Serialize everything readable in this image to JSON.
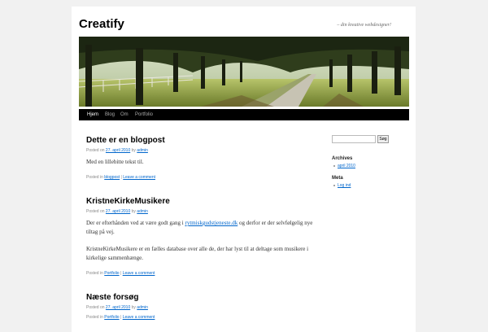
{
  "site": {
    "title": "Creatify",
    "description": "– din kreative webdesigner!"
  },
  "menu": {
    "items": [
      {
        "label": "Hjem",
        "current": true
      },
      {
        "label": "Blog",
        "current": false
      },
      {
        "label": "Om",
        "current": false
      },
      {
        "label": "Portfolio",
        "current": false
      }
    ]
  },
  "posts": [
    {
      "title": "Dette er en blogpost",
      "meta_prefix": "Posted on",
      "date": "27. april 2010",
      "meta_by": "by",
      "author": "admin",
      "paragraphs": [
        {
          "text": "Med en lillebitte tekst til."
        }
      ],
      "util_prefix": "Posted in",
      "category": "blogpost",
      "separator": "|",
      "comment_link": "Leave a comment"
    },
    {
      "title": "KristneKirkeMusikere",
      "meta_prefix": "Posted on",
      "date": "27. april 2010",
      "meta_by": "by",
      "author": "admin",
      "paragraphs": [
        {
          "before": "Der er efterhånden ved at være godt gang i ",
          "link": "rytmiskgudstjeneste.dk",
          "after": " og derfor er der selvfølgelig nye tiltag på vej."
        },
        {
          "text": "KristneKirkeMusikere er en fælles database over alle de, der har lyst til at deltage som musikere i kirkelige sammenhænge."
        }
      ],
      "util_prefix": "Posted in",
      "category": "Portfolio",
      "separator": "|",
      "comment_link": "Leave a comment"
    },
    {
      "title": "Næste forsøg",
      "meta_prefix": "Posted on",
      "date": "27. april 2010",
      "meta_by": "by",
      "author": "admin",
      "paragraphs": [],
      "util_prefix": "Posted in",
      "category": "Portfolio",
      "separator": "|",
      "comment_link": "Leave a comment"
    }
  ],
  "sidebar": {
    "search": {
      "value": "",
      "button_label": "Søg"
    },
    "archives": {
      "title": "Archives",
      "items": [
        "april 2010"
      ]
    },
    "meta": {
      "title": "Meta",
      "items": [
        "Log ind"
      ]
    }
  },
  "colors": {
    "link": "#0066cc",
    "menu_bg": "#000000",
    "page_bg": "#f1f1f1"
  }
}
